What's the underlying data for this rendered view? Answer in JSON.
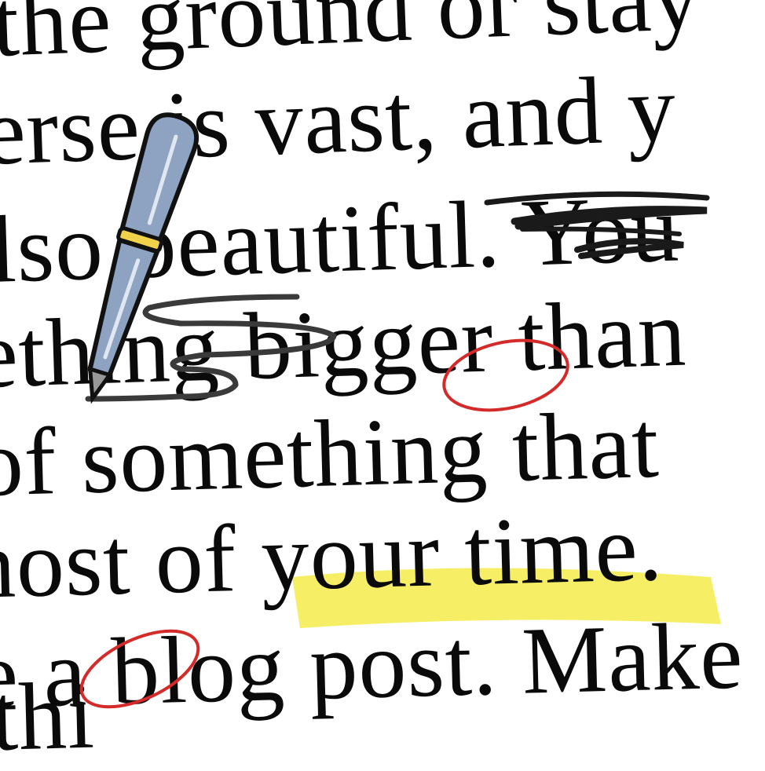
{
  "text_lines": [
    "the ground or stay",
    "erse is vast, and y",
    "lso beautiful. You",
    "ething bigger than",
    "of something that",
    "nost of your time.",
    "e a blog post. Make",
    "thi"
  ],
  "colors": {
    "text": "#0a0a0a",
    "highlight": "#f5ec4a",
    "red_circle": "#d42a2a",
    "pen_body": "#8ea3c2",
    "pen_band": "#f2d24a",
    "scribble": "#1a1a1a"
  },
  "icons": [
    "pen-icon"
  ]
}
